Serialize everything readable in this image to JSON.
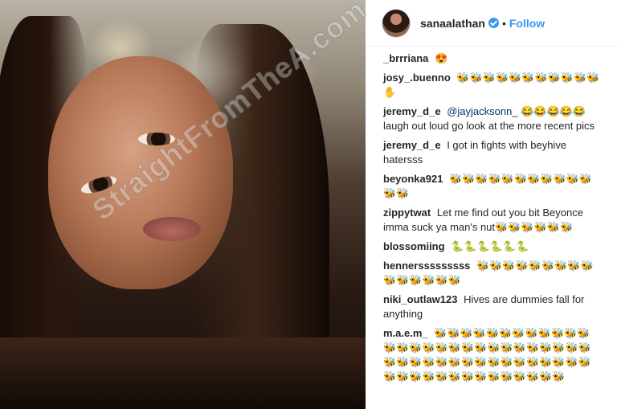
{
  "post": {
    "username": "sanaalathan",
    "verified_icon": "verified-badge-icon",
    "separator": "•",
    "follow_label": "Follow",
    "accent_color": "#3897f0"
  },
  "watermark": "StraightFromTheA.com",
  "comments": [
    {
      "user": "_brrriana",
      "text": "😍"
    },
    {
      "user": "josy_.buenno",
      "text": "🐝🐝🐝🐝🐝🐝🐝🐝🐝🐝🐝✋"
    },
    {
      "user": "jeremy_d_e",
      "mention": "@jayjacksonn_",
      "text": " 😂😂😂😂😂 laugh out loud go look at the more recent pics"
    },
    {
      "user": "jeremy_d_e",
      "text": "I got in fights with beyhive hatersss"
    },
    {
      "user": "beyonka921",
      "text": "🐝🐝🐝🐝🐝🐝🐝🐝🐝🐝🐝🐝🐝"
    },
    {
      "user": "zippytwat",
      "text": "Let me find out you bit Beyonce imma suck ya man's nut🐝🐝🐝🐝🐝🐝"
    },
    {
      "user": "blossomiing",
      "text": "🐍🐍🐍🐍🐍🐍"
    },
    {
      "user": "hennersssssssss",
      "text": "🐝🐝🐝🐝🐝🐝🐝🐝🐝🐝🐝🐝🐝🐝🐝"
    },
    {
      "user": "niki_outlaw123",
      "text": "Hives are dummies fall for anything"
    },
    {
      "user": "m.a.e.m_",
      "text": "🐝🐝🐝🐝🐝🐝🐝🐝🐝🐝🐝🐝🐝🐝🐝🐝🐝🐝🐝🐝🐝🐝🐝🐝🐝🐝🐝🐝🐝🐝🐝🐝🐝🐝🐝🐝🐝🐝🐝🐝🐝🐝🐝🐝🐝🐝🐝🐝🐝🐝🐝🐝🐝🐝🐝🐝🐝🐝"
    }
  ]
}
